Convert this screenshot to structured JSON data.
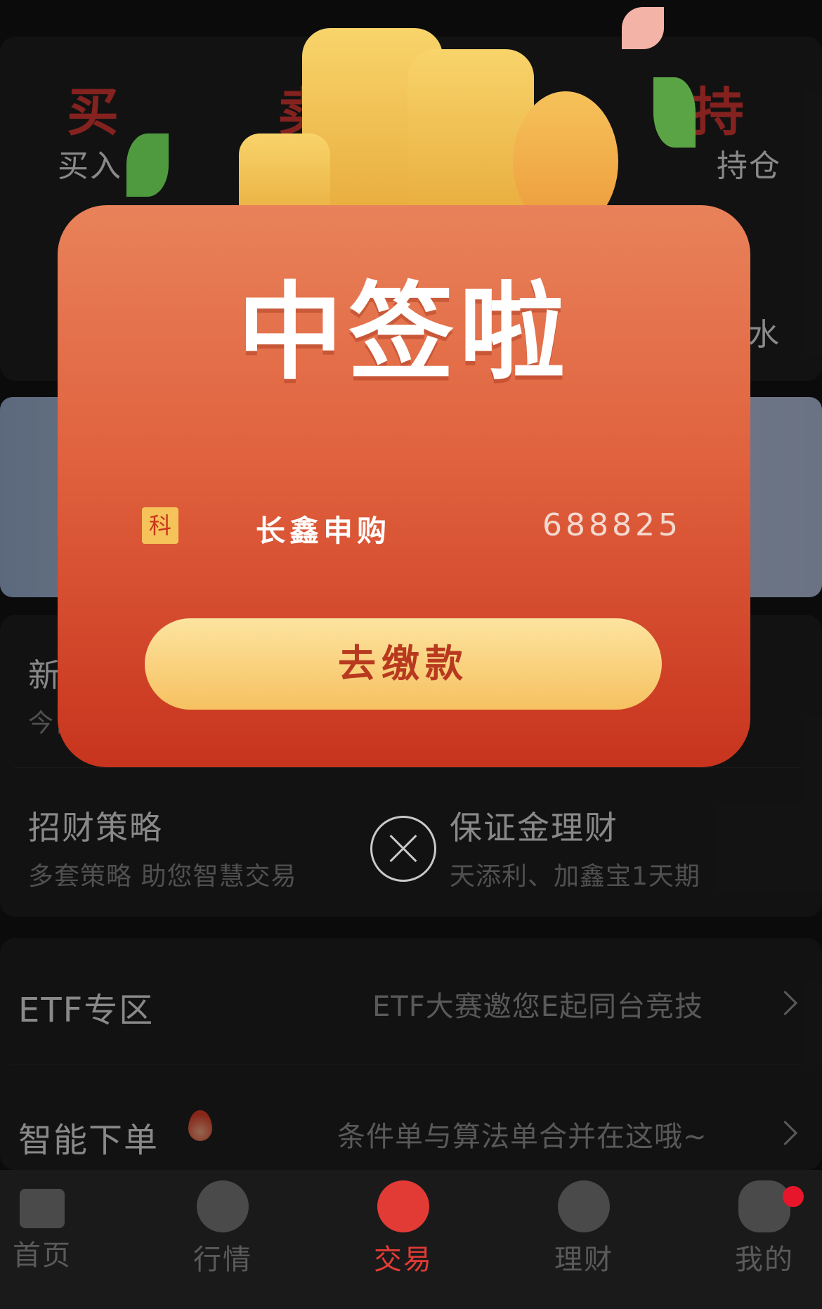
{
  "trade_panel": {
    "buy_big": "买",
    "buy_label": "买入",
    "sell_big_partial": "卖",
    "hold_big_partial": "持",
    "hold_label_partial": "持仓",
    "flow_label_partial": "水"
  },
  "new_stock": {
    "title_partial": "新",
    "subtitle_partial": "今日"
  },
  "strategy": {
    "title": "招财策略",
    "subtitle": "多套策略 助您智慧交易"
  },
  "margin": {
    "title": "保证金理财",
    "subtitle": "天添利、加鑫宝1天期"
  },
  "etf": {
    "title": "ETF专区",
    "promo": "ETF大赛邀您E起同台竞技"
  },
  "smart_order": {
    "title": "智能下单",
    "promo": "条件单与算法单合并在这哦~"
  },
  "tabbar": [
    {
      "label": "首页",
      "icon": "home-icon"
    },
    {
      "label": "行情",
      "icon": "market-trend-icon"
    },
    {
      "label": "交易",
      "icon": "trade-exchange-icon",
      "active": true
    },
    {
      "label": "理财",
      "icon": "diamond-icon"
    },
    {
      "label": "我的",
      "icon": "bull-avatar-icon",
      "badge": true
    }
  ],
  "popup": {
    "headline": "中签啦",
    "badge": "科",
    "stock_name": "长鑫申购",
    "stock_code": "688825",
    "pay_button": "去缴款"
  },
  "colors": {
    "accent_red": "#e23b36",
    "popup_top": "#e8825a",
    "popup_bottom": "#c8341e",
    "gold": "#f6c25a"
  }
}
